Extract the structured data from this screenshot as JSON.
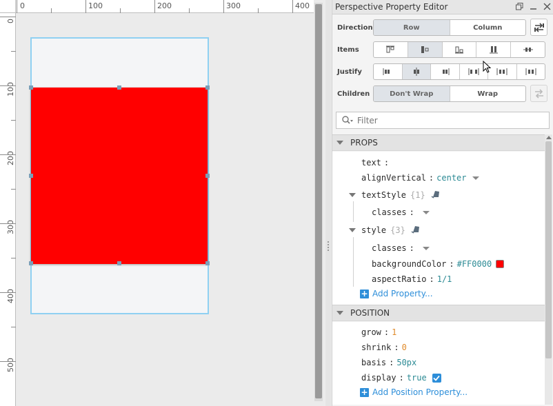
{
  "ruler": {
    "top_labels": [
      "0",
      "100",
      "200",
      "300",
      "400"
    ],
    "left_labels": [
      "0",
      "100",
      "200",
      "300",
      "400",
      "500"
    ]
  },
  "panel": {
    "title": "Perspective Property Editor",
    "direction_label": "Direction",
    "direction_options": [
      "Row",
      "Column"
    ],
    "direction_selected": "Row",
    "items_label": "Items",
    "justify_label": "Justify",
    "children_label": "Children",
    "wrap_options": [
      "Don't Wrap",
      "Wrap"
    ],
    "wrap_selected": "Don't Wrap",
    "filter_placeholder": "Filter"
  },
  "props": {
    "header": "PROPS",
    "text_key": "text",
    "alignVertical_key": "alignVertical",
    "alignVertical_val": "center",
    "textStyle_key": "textStyle",
    "textStyle_count": "{1}",
    "classes_key": "classes",
    "style_key": "style",
    "style_count": "{3}",
    "style_classes_key": "classes",
    "backgroundColor_key": "backgroundColor",
    "backgroundColor_val": "#FF0000",
    "aspectRatio_key": "aspectRatio",
    "aspectRatio_val": "1/1",
    "add_label": "Add Property..."
  },
  "position": {
    "header": "POSITION",
    "grow_key": "grow",
    "grow_val": "1",
    "shrink_key": "shrink",
    "shrink_val": "0",
    "basis_key": "basis",
    "basis_val": "50px",
    "display_key": "display",
    "display_val": "true",
    "add_label": "Add Position Property..."
  },
  "colors": {
    "component_fill": "#FF0000",
    "selection_border": "#8FD0F2",
    "accent": "#2D8ED9"
  }
}
